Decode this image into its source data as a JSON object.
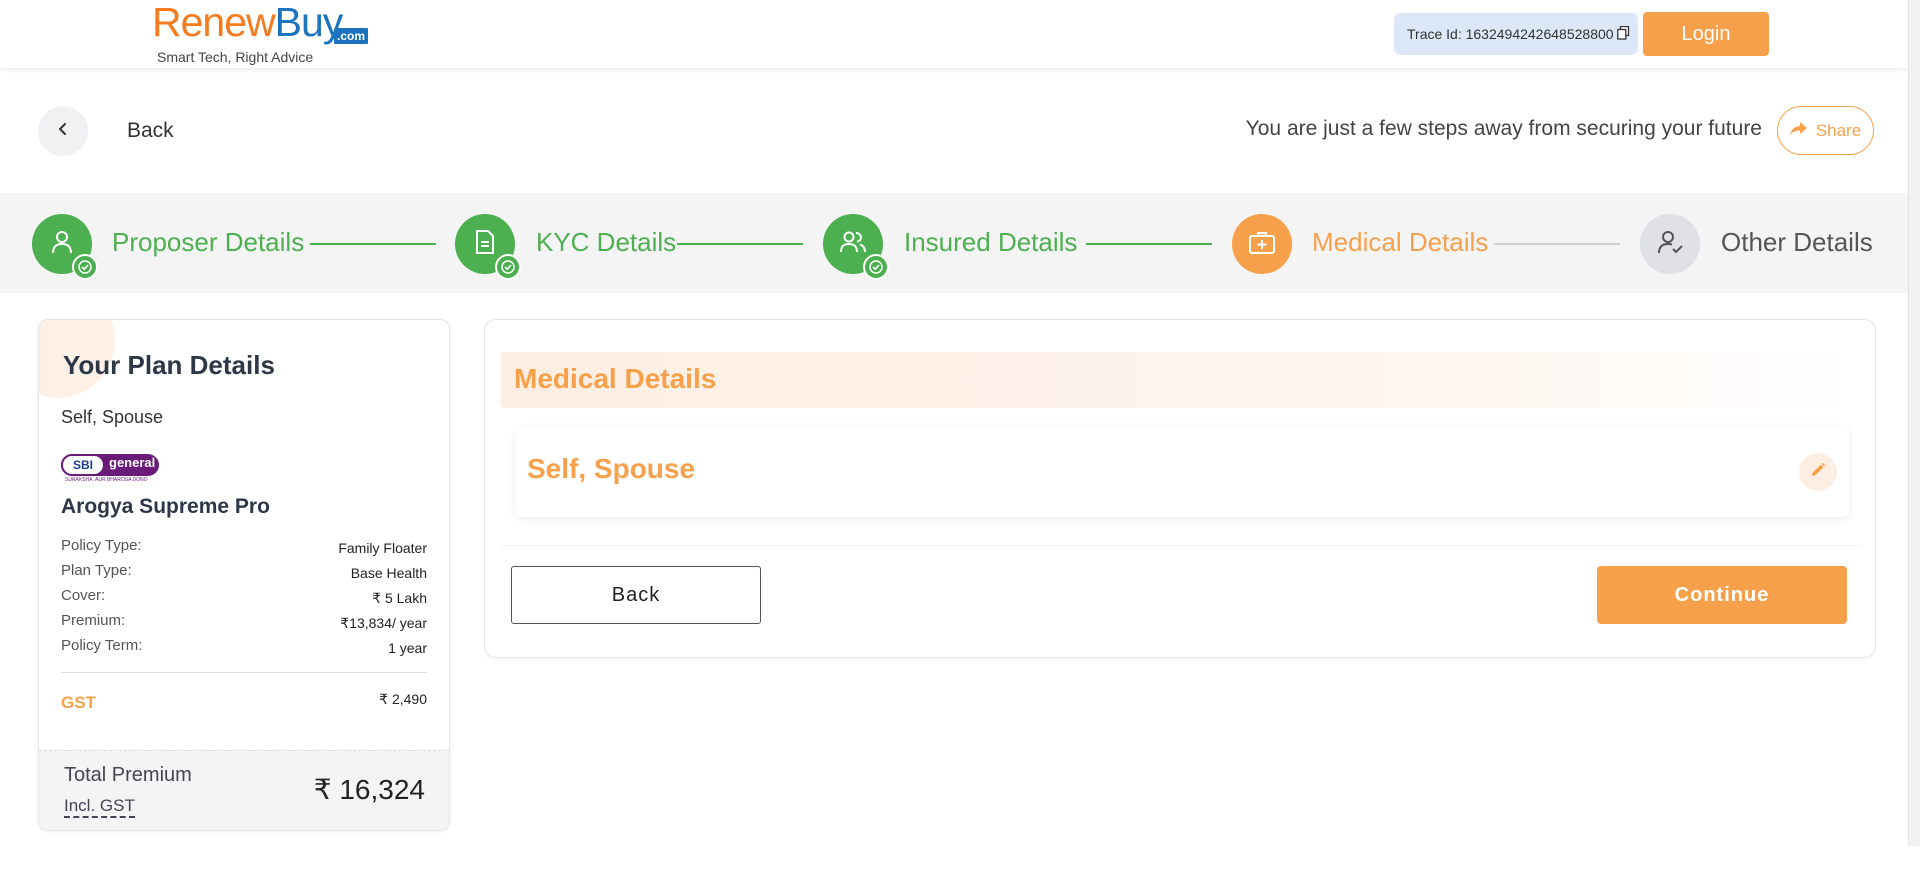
{
  "header": {
    "logo_renew": "Renew",
    "logo_buy": "Buy",
    "logo_com": ".com",
    "logo_tagline": "Smart Tech, Right Advice",
    "trace_id": "Trace Id: 1632494242648528800",
    "login_label": "Login"
  },
  "nav": {
    "back_label": "Back",
    "tagline": "You are just a few steps away from securing your future",
    "share_label": "Share"
  },
  "steps": [
    {
      "label": "Proposer Details",
      "status": "done",
      "icon": "user-icon"
    },
    {
      "label": "KYC Details",
      "status": "done",
      "icon": "document-icon"
    },
    {
      "label": "Insured Details",
      "status": "done",
      "icon": "users-icon"
    },
    {
      "label": "Medical Details",
      "status": "active",
      "icon": "medical-kit-icon"
    },
    {
      "label": "Other Details",
      "status": "pending",
      "icon": "user-check-icon"
    }
  ],
  "plan": {
    "title": "Your Plan Details",
    "members": "Self, Spouse",
    "insurer_logo_text": "SBI",
    "insurer_logo_text2": "general",
    "insurer_logo_sub": "SURAKSHA, AUR BHAROSA DONO",
    "name": "Arogya Supreme Pro",
    "details": [
      {
        "key": "Policy Type:",
        "value": "Family Floater"
      },
      {
        "key": "Plan Type:",
        "value": "Base Health"
      },
      {
        "key": "Cover:",
        "value": "₹ 5 Lakh"
      },
      {
        "key": "Premium:",
        "value": "₹13,834/ year"
      },
      {
        "key": "Policy Term:",
        "value": "1 year"
      }
    ],
    "gst_label": "GST",
    "gst_value": "₹ 2,490",
    "total_label": "Total Premium",
    "total_incl": "Incl. GST",
    "total_amount": "₹ 16,324"
  },
  "medical": {
    "title": "Medical Details",
    "member": "Self, Spouse",
    "back_button": "Back",
    "continue_button": "Continue"
  },
  "colors": {
    "accent": "#f7a04b",
    "success": "#4caf50",
    "pending": "#dfe1e6",
    "brand_orange": "#f47b20",
    "brand_blue": "#1e73be"
  }
}
